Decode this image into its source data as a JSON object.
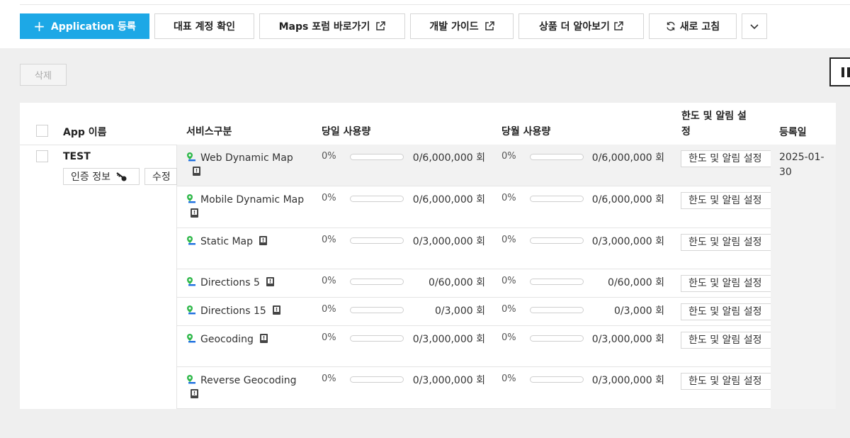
{
  "toolbar": {
    "register_label": "Application 등록",
    "account_label": "대표 계정 확인",
    "forum_label": "Maps 포럼 바로가기",
    "guide_label": "개발 가이드",
    "product_label": "상품 더 알아보기",
    "refresh_label": "새로 고침"
  },
  "actions": {
    "delete_label": "삭제"
  },
  "table": {
    "headers": {
      "app_name": "App 이름",
      "service": "서비스구분",
      "daily": "당일 사용량",
      "monthly": "당월 사용량",
      "limit_line1": "한도 및 알림 설",
      "limit_line2": "정",
      "registered": "등록일"
    },
    "app": {
      "name": "TEST",
      "auth_label": "인증 정보",
      "edit_label": "수정",
      "registered": "2025-01-30"
    },
    "rows": [
      {
        "service": "Web Dynamic Map",
        "daily_pct": "0%",
        "daily_fraction": 0,
        "daily_qty": "0/6,000,000",
        "daily_unit": "회",
        "monthly_pct": "0%",
        "monthly_fraction": 0,
        "monthly_qty": "0/6,000,000",
        "monthly_unit": "회",
        "limit_label": "한도 및 알림 설정"
      },
      {
        "service": "Mobile Dynamic Map",
        "daily_pct": "0%",
        "daily_fraction": 0,
        "daily_qty": "0/6,000,000",
        "daily_unit": "회",
        "monthly_pct": "0%",
        "monthly_fraction": 0,
        "monthly_qty": "0/6,000,000",
        "monthly_unit": "회",
        "limit_label": "한도 및 알림 설정"
      },
      {
        "service": "Static Map",
        "daily_pct": "0%",
        "daily_fraction": 0,
        "daily_qty": "0/3,000,000",
        "daily_unit": "회",
        "monthly_pct": "0%",
        "monthly_fraction": 0,
        "monthly_qty": "0/3,000,000",
        "monthly_unit": "회",
        "limit_label": "한도 및 알림 설정"
      },
      {
        "service": "Directions 5",
        "daily_pct": "0%",
        "daily_fraction": 0,
        "daily_qty": "0/60,000",
        "daily_unit": "회",
        "monthly_pct": "0%",
        "monthly_fraction": 0,
        "monthly_qty": "0/60,000",
        "monthly_unit": "회",
        "limit_label": "한도 및 알림 설정"
      },
      {
        "service": "Directions 15",
        "daily_pct": "0%",
        "daily_fraction": 0,
        "daily_qty": "0/3,000",
        "daily_unit": "회",
        "monthly_pct": "0%",
        "monthly_fraction": 0,
        "monthly_qty": "0/3,000",
        "monthly_unit": "회",
        "limit_label": "한도 및 알림 설정"
      },
      {
        "service": "Geocoding",
        "daily_pct": "0%",
        "daily_fraction": 0,
        "daily_qty": "0/3,000,000",
        "daily_unit": "회",
        "monthly_pct": "0%",
        "monthly_fraction": 0,
        "monthly_qty": "0/3,000,000",
        "monthly_unit": "회",
        "limit_label": "한도 및 알림 설정"
      },
      {
        "service": "Reverse Geocoding",
        "daily_pct": "0%",
        "daily_fraction": 0,
        "daily_qty": "0/3,000,000",
        "daily_unit": "회",
        "monthly_pct": "0%",
        "monthly_fraction": 0,
        "monthly_qty": "0/3,000,000",
        "monthly_unit": "회",
        "limit_label": "한도 및 알림 설정"
      }
    ]
  },
  "colors": {
    "accent": "#1da8e6",
    "pin_green": "#2fb84a",
    "pin_blue": "#1d6fe0"
  }
}
